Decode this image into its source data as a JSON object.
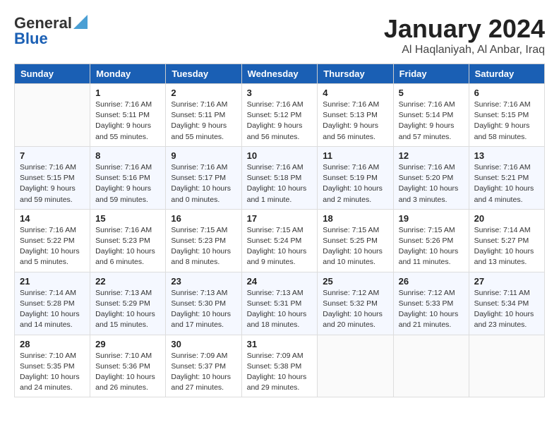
{
  "header": {
    "logo_line1": "General",
    "logo_line2": "Blue",
    "title": "January 2024",
    "subtitle": "Al Haqlaniyah, Al Anbar, Iraq"
  },
  "columns": [
    "Sunday",
    "Monday",
    "Tuesday",
    "Wednesday",
    "Thursday",
    "Friday",
    "Saturday"
  ],
  "weeks": [
    [
      {
        "day": "",
        "info": ""
      },
      {
        "day": "1",
        "info": "Sunrise: 7:16 AM\nSunset: 5:11 PM\nDaylight: 9 hours\nand 55 minutes."
      },
      {
        "day": "2",
        "info": "Sunrise: 7:16 AM\nSunset: 5:11 PM\nDaylight: 9 hours\nand 55 minutes."
      },
      {
        "day": "3",
        "info": "Sunrise: 7:16 AM\nSunset: 5:12 PM\nDaylight: 9 hours\nand 56 minutes."
      },
      {
        "day": "4",
        "info": "Sunrise: 7:16 AM\nSunset: 5:13 PM\nDaylight: 9 hours\nand 56 minutes."
      },
      {
        "day": "5",
        "info": "Sunrise: 7:16 AM\nSunset: 5:14 PM\nDaylight: 9 hours\nand 57 minutes."
      },
      {
        "day": "6",
        "info": "Sunrise: 7:16 AM\nSunset: 5:15 PM\nDaylight: 9 hours\nand 58 minutes."
      }
    ],
    [
      {
        "day": "7",
        "info": "Sunrise: 7:16 AM\nSunset: 5:15 PM\nDaylight: 9 hours\nand 59 minutes."
      },
      {
        "day": "8",
        "info": "Sunrise: 7:16 AM\nSunset: 5:16 PM\nDaylight: 9 hours\nand 59 minutes."
      },
      {
        "day": "9",
        "info": "Sunrise: 7:16 AM\nSunset: 5:17 PM\nDaylight: 10 hours\nand 0 minutes."
      },
      {
        "day": "10",
        "info": "Sunrise: 7:16 AM\nSunset: 5:18 PM\nDaylight: 10 hours\nand 1 minute."
      },
      {
        "day": "11",
        "info": "Sunrise: 7:16 AM\nSunset: 5:19 PM\nDaylight: 10 hours\nand 2 minutes."
      },
      {
        "day": "12",
        "info": "Sunrise: 7:16 AM\nSunset: 5:20 PM\nDaylight: 10 hours\nand 3 minutes."
      },
      {
        "day": "13",
        "info": "Sunrise: 7:16 AM\nSunset: 5:21 PM\nDaylight: 10 hours\nand 4 minutes."
      }
    ],
    [
      {
        "day": "14",
        "info": "Sunrise: 7:16 AM\nSunset: 5:22 PM\nDaylight: 10 hours\nand 5 minutes."
      },
      {
        "day": "15",
        "info": "Sunrise: 7:16 AM\nSunset: 5:23 PM\nDaylight: 10 hours\nand 6 minutes."
      },
      {
        "day": "16",
        "info": "Sunrise: 7:15 AM\nSunset: 5:23 PM\nDaylight: 10 hours\nand 8 minutes."
      },
      {
        "day": "17",
        "info": "Sunrise: 7:15 AM\nSunset: 5:24 PM\nDaylight: 10 hours\nand 9 minutes."
      },
      {
        "day": "18",
        "info": "Sunrise: 7:15 AM\nSunset: 5:25 PM\nDaylight: 10 hours\nand 10 minutes."
      },
      {
        "day": "19",
        "info": "Sunrise: 7:15 AM\nSunset: 5:26 PM\nDaylight: 10 hours\nand 11 minutes."
      },
      {
        "day": "20",
        "info": "Sunrise: 7:14 AM\nSunset: 5:27 PM\nDaylight: 10 hours\nand 13 minutes."
      }
    ],
    [
      {
        "day": "21",
        "info": "Sunrise: 7:14 AM\nSunset: 5:28 PM\nDaylight: 10 hours\nand 14 minutes."
      },
      {
        "day": "22",
        "info": "Sunrise: 7:13 AM\nSunset: 5:29 PM\nDaylight: 10 hours\nand 15 minutes."
      },
      {
        "day": "23",
        "info": "Sunrise: 7:13 AM\nSunset: 5:30 PM\nDaylight: 10 hours\nand 17 minutes."
      },
      {
        "day": "24",
        "info": "Sunrise: 7:13 AM\nSunset: 5:31 PM\nDaylight: 10 hours\nand 18 minutes."
      },
      {
        "day": "25",
        "info": "Sunrise: 7:12 AM\nSunset: 5:32 PM\nDaylight: 10 hours\nand 20 minutes."
      },
      {
        "day": "26",
        "info": "Sunrise: 7:12 AM\nSunset: 5:33 PM\nDaylight: 10 hours\nand 21 minutes."
      },
      {
        "day": "27",
        "info": "Sunrise: 7:11 AM\nSunset: 5:34 PM\nDaylight: 10 hours\nand 23 minutes."
      }
    ],
    [
      {
        "day": "28",
        "info": "Sunrise: 7:10 AM\nSunset: 5:35 PM\nDaylight: 10 hours\nand 24 minutes."
      },
      {
        "day": "29",
        "info": "Sunrise: 7:10 AM\nSunset: 5:36 PM\nDaylight: 10 hours\nand 26 minutes."
      },
      {
        "day": "30",
        "info": "Sunrise: 7:09 AM\nSunset: 5:37 PM\nDaylight: 10 hours\nand 27 minutes."
      },
      {
        "day": "31",
        "info": "Sunrise: 7:09 AM\nSunset: 5:38 PM\nDaylight: 10 hours\nand 29 minutes."
      },
      {
        "day": "",
        "info": ""
      },
      {
        "day": "",
        "info": ""
      },
      {
        "day": "",
        "info": ""
      }
    ]
  ]
}
